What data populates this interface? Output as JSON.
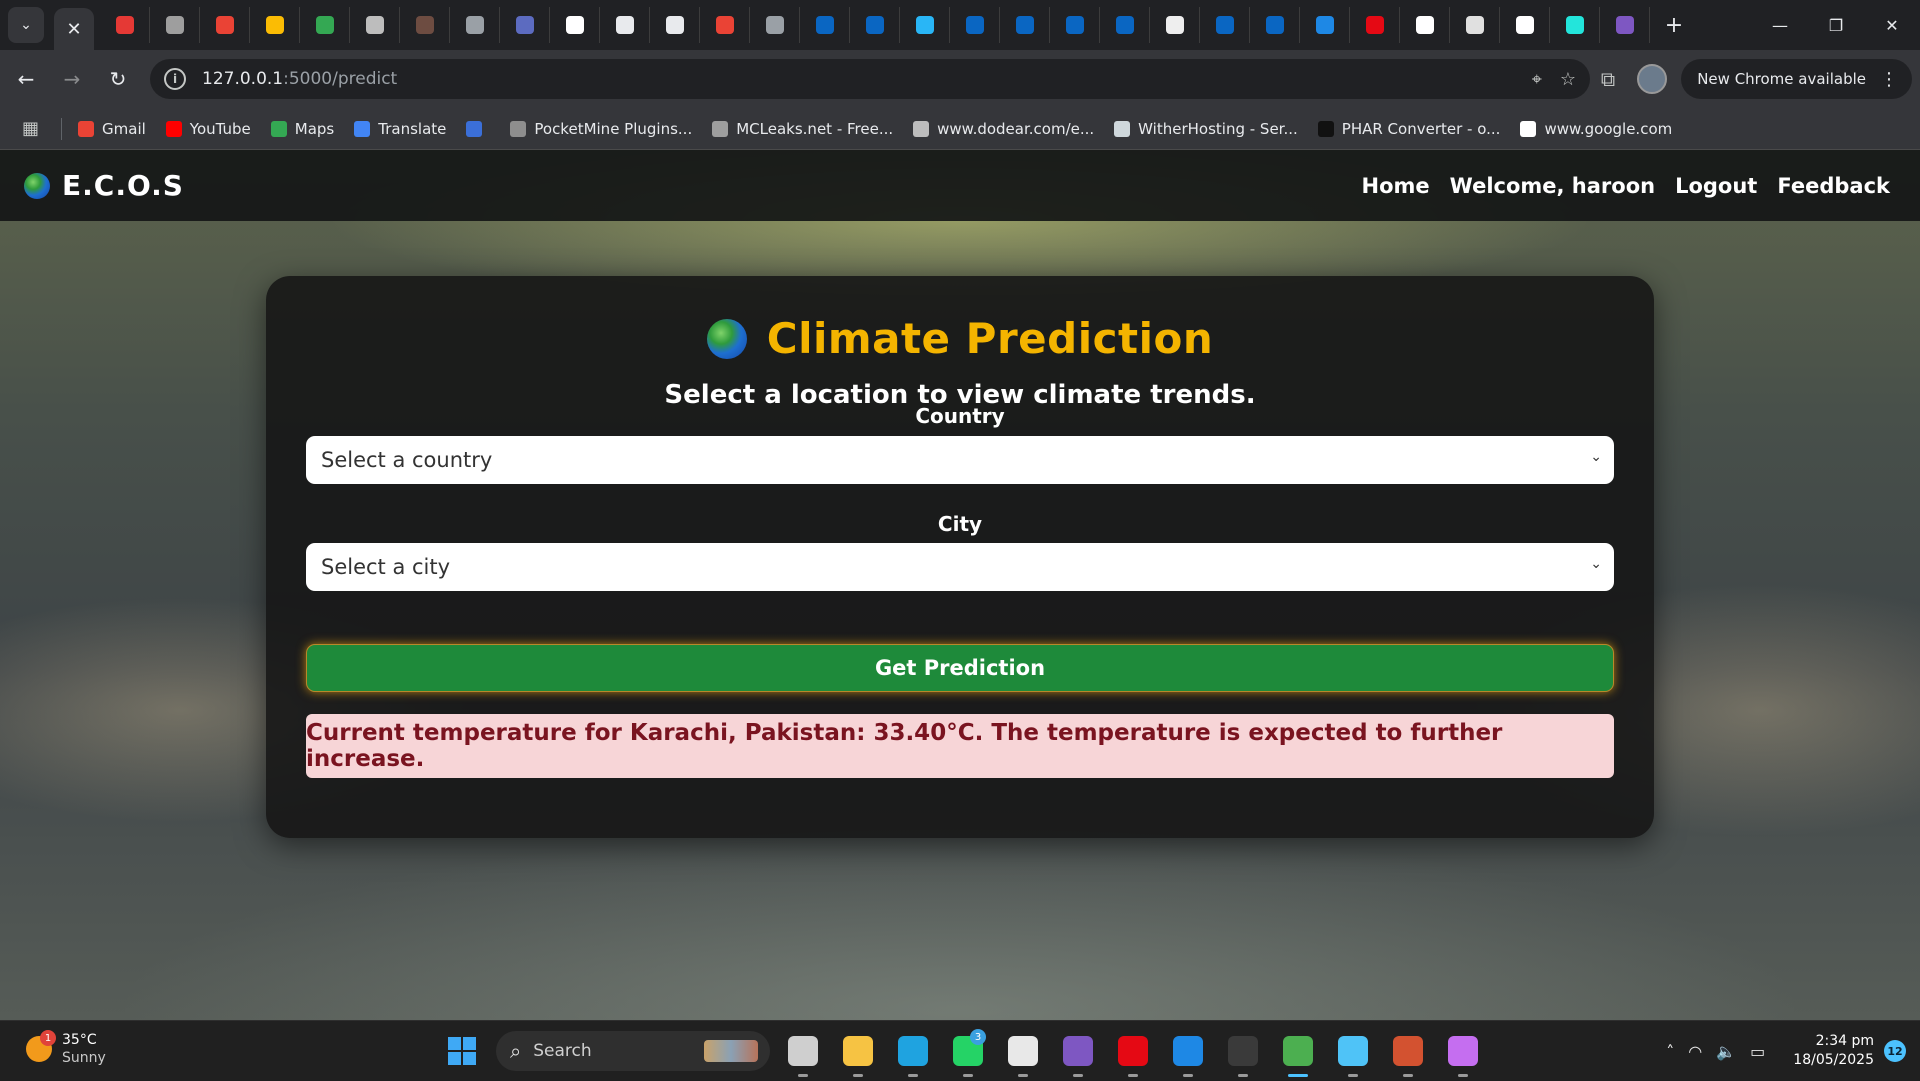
{
  "browser": {
    "tabs": [
      {
        "icon": "tab-icon-red-grid",
        "color": "#e53935"
      },
      {
        "icon": "tab-icon-id-card",
        "color": "#9e9e9e"
      },
      {
        "icon": "tab-icon-gmail",
        "color": "#ea4335"
      },
      {
        "icon": "tab-icon-google-drive",
        "color": "#fbbc04"
      },
      {
        "icon": "tab-icon-google-drive",
        "color": "#34a853"
      },
      {
        "icon": "tab-icon-history",
        "color": "#bdbdbd"
      },
      {
        "icon": "tab-icon-loading",
        "color": "#6d4c41"
      },
      {
        "icon": "tab-icon-globe",
        "color": "#9aa0a6"
      },
      {
        "icon": "tab-icon-calculator",
        "color": "#5c6bc0"
      },
      {
        "icon": "tab-icon-google",
        "color": "#ffffff"
      },
      {
        "icon": "tab-icon-chrome",
        "color": "#e8eaed"
      },
      {
        "icon": "tab-icon-openai",
        "color": "#e8eaed"
      },
      {
        "icon": "tab-icon-gmail",
        "color": "#ea4335"
      },
      {
        "icon": "tab-icon-globe",
        "color": "#9aa0a6"
      },
      {
        "icon": "tab-icon-linkedin",
        "color": "#0a66c2"
      },
      {
        "icon": "tab-icon-linkedin",
        "color": "#0a66c2"
      },
      {
        "icon": "tab-icon-spiral",
        "color": "#29b6f6"
      },
      {
        "icon": "tab-icon-linkedin",
        "color": "#0a66c2"
      },
      {
        "icon": "tab-icon-linkedin",
        "color": "#0a66c2"
      },
      {
        "icon": "tab-icon-linkedin",
        "color": "#0a66c2"
      },
      {
        "icon": "tab-icon-linkedin",
        "color": "#0a66c2"
      },
      {
        "icon": "tab-icon-translate",
        "color": "#eeeeee"
      },
      {
        "icon": "tab-icon-linkedin",
        "color": "#0a66c2"
      },
      {
        "icon": "tab-icon-linkedin",
        "color": "#0a66c2"
      },
      {
        "icon": "tab-icon-headset",
        "color": "#1e88e5"
      },
      {
        "icon": "tab-icon-n-logo",
        "color": "#e50914"
      },
      {
        "icon": "tab-icon-info",
        "color": "#ffffff"
      },
      {
        "icon": "tab-icon-bot",
        "color": "#e0e0e0"
      },
      {
        "icon": "tab-icon-google",
        "color": "#ffffff"
      },
      {
        "icon": "tab-icon-olx",
        "color": "#23e5db"
      },
      {
        "icon": "tab-icon-list",
        "color": "#7e57c2"
      }
    ],
    "url_host": "127.0.0.1",
    "url_path": ":5000/predict",
    "update_label": "New Chrome available",
    "bookmarks": [
      {
        "label": "Gmail",
        "color": "#ea4335"
      },
      {
        "label": "YouTube",
        "color": "#ff0000"
      },
      {
        "label": "Maps",
        "color": "#34a853"
      },
      {
        "label": "Translate",
        "color": "#4285f4"
      },
      {
        "label": "",
        "color": "#3b6fd8"
      },
      {
        "label": "PocketMine Plugins...",
        "color": "#8e8e8e"
      },
      {
        "label": "MCLeaks.net - Free...",
        "color": "#9e9e9e"
      },
      {
        "label": "www.dodear.com/e...",
        "color": "#bdbdbd"
      },
      {
        "label": "WitherHosting - Ser...",
        "color": "#cfd8dc"
      },
      {
        "label": "PHAR Converter - o...",
        "color": "#111111"
      },
      {
        "label": "www.google.com",
        "color": "#ffffff"
      }
    ]
  },
  "site": {
    "brand": "E.C.O.S",
    "nav": [
      "Home",
      "Welcome, haroon",
      "Logout",
      "Feedback"
    ],
    "title": "Climate Prediction",
    "subtitle": "Select a location to view climate trends.",
    "country_label": "Country",
    "country_placeholder": "Select a country",
    "city_label": "City",
    "city_placeholder": "Select a city",
    "button_label": "Get Prediction",
    "result_text": "Current temperature for Karachi, Pakistan: 33.40°C. The temperature is expected to further increase.",
    "colors": {
      "accent": "#f4b400",
      "button": "#1e8a3a",
      "result_bg": "#f7d5d7",
      "result_text": "#7a1420"
    }
  },
  "taskbar": {
    "temp": "35°C",
    "condition": "Sunny",
    "weather_badge": "1",
    "search_label": "Search",
    "apps": [
      {
        "icon": "task-view-icon",
        "color": "#cfcfcf"
      },
      {
        "icon": "file-explorer-icon",
        "color": "#f6c343"
      },
      {
        "icon": "edge-icon",
        "color": "#1fa3e0"
      },
      {
        "icon": "whatsapp-icon",
        "color": "#25d366",
        "count": "3"
      },
      {
        "icon": "microsoft-store-icon",
        "color": "#e8e8e8"
      },
      {
        "icon": "clipchamp-icon",
        "color": "#7e57c2"
      },
      {
        "icon": "netflix-icon",
        "color": "#e50914"
      },
      {
        "icon": "vscode-icon",
        "color": "#1e88e5"
      },
      {
        "icon": "terminal-icon",
        "color": "#3a3a3a"
      },
      {
        "icon": "chrome-icon",
        "color": "#4caf50",
        "active": true
      },
      {
        "icon": "notepad-icon",
        "color": "#4fc3f7"
      },
      {
        "icon": "powerpoint-icon",
        "color": "#d35230"
      },
      {
        "icon": "copilot-icon",
        "color": "#c56ef0"
      }
    ],
    "time": "2:34 pm",
    "date": "18/05/2025",
    "notifications": "12"
  }
}
